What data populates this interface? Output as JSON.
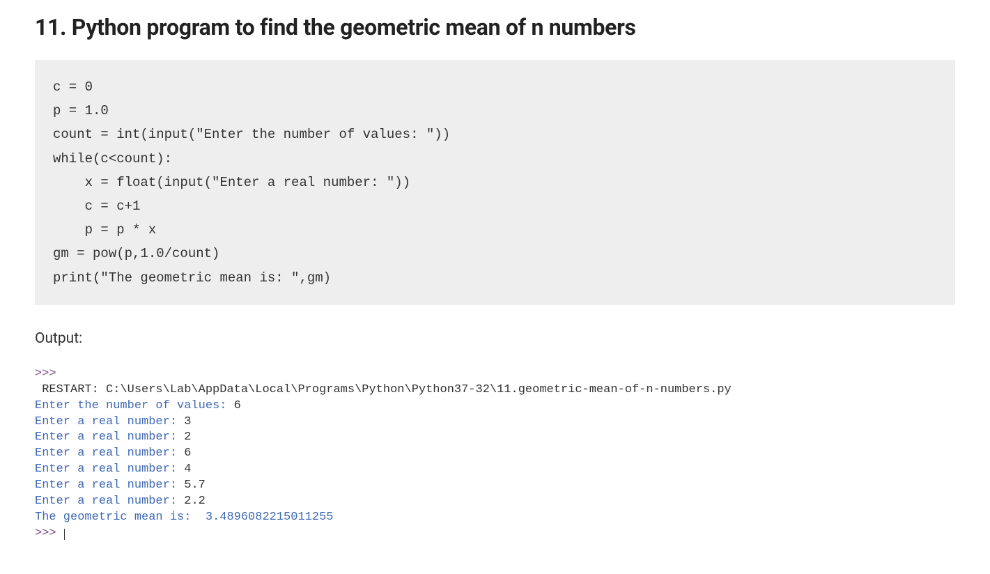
{
  "heading": "11. Python program to find the geometric mean of n numbers",
  "code": "c = 0\np = 1.0\ncount = int(input(\"Enter the number of values: \"))\nwhile(c<count):\n    x = float(input(\"Enter a real number: \"))\n    c = c+1\n    p = p * x\ngm = pow(p,1.0/count)\nprint(\"The geometric mean is: \",gm)",
  "output_label": "Output:",
  "terminal": {
    "prompt1": ">>> ",
    "restart": " RESTART: C:\\Users\\Lab\\AppData\\Local\\Programs\\Python\\Python37-32\\11.geometric-mean-of-n-numbers.py",
    "lines": [
      {
        "prompt": "Enter the number of values: ",
        "input": "6"
      },
      {
        "prompt": "Enter a real number: ",
        "input": "3"
      },
      {
        "prompt": "Enter a real number: ",
        "input": "2"
      },
      {
        "prompt": "Enter a real number: ",
        "input": "6"
      },
      {
        "prompt": "Enter a real number: ",
        "input": "4"
      },
      {
        "prompt": "Enter a real number: ",
        "input": "5.7"
      },
      {
        "prompt": "Enter a real number: ",
        "input": "2.2"
      }
    ],
    "result_label": "The geometric mean is:  ",
    "result_value": "3.4896082215011255",
    "prompt2": ">>> "
  }
}
